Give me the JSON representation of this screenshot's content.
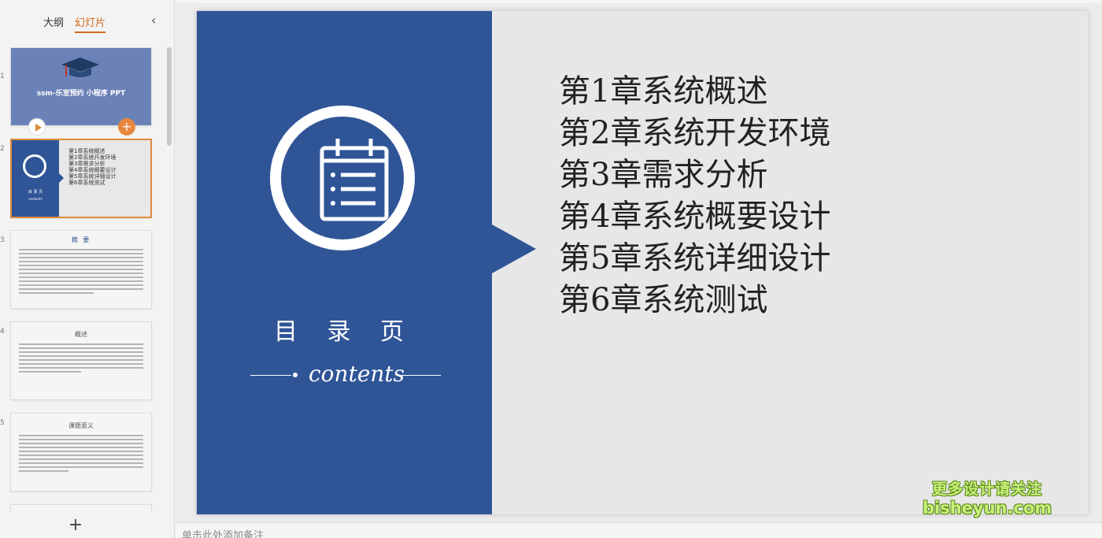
{
  "left_panel": {
    "tabs": [
      {
        "label": "大纲",
        "active": false
      },
      {
        "label": "幻灯片",
        "active": true
      }
    ],
    "collapse_icon": "chevron-left-icon",
    "add_slide_icon": "plus-icon",
    "thumbnails": {
      "slide1": {
        "number": "1",
        "title": "ssm-乐室预约 小程序 PPT"
      },
      "slide2": {
        "number": "2",
        "label": "目 录 页",
        "contents": "contents",
        "items": [
          "第1章系统概述",
          "第2章系统开发环境",
          "第3章需求分析",
          "第4章系统概要设计",
          "第5章系统详细设计",
          "第6章系统测试"
        ]
      },
      "slide3": {
        "number": "3",
        "heading": "摘  要"
      },
      "slide4": {
        "number": "4",
        "heading": "概述"
      },
      "slide5": {
        "number": "5",
        "heading": "课题意义"
      }
    }
  },
  "slide": {
    "left_color": "#2f5597",
    "label": "目 录 页",
    "contents": "contents",
    "toc": [
      "第1章系统概述",
      "第2章系统开发环境",
      "第3章需求分析",
      "第4章系统概要设计",
      "第5章系统详细设计",
      "第6章系统测试"
    ]
  },
  "watermark": {
    "line1": "更多设计请关注",
    "line2": "bisheyun.com"
  },
  "notes": {
    "placeholder": "单击此处添加备注"
  },
  "colors": {
    "accent": "#e08a3c",
    "slide_blue": "#2f5597"
  }
}
